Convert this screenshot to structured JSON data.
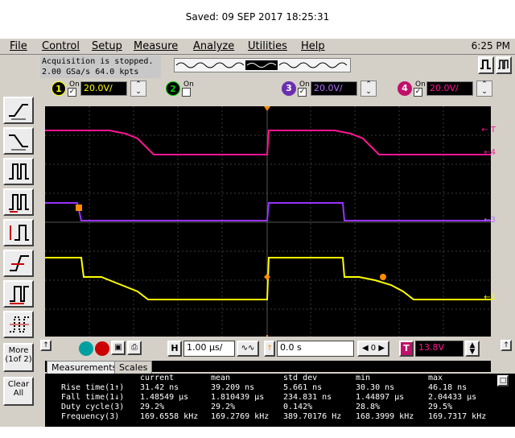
{
  "saved_caption": "Saved:  09 SEP 2017  18:25:31",
  "menu": {
    "items": [
      "File",
      "Control",
      "Setup",
      "Measure",
      "Analyze",
      "Utilities",
      "Help"
    ],
    "clock": "6:25 PM"
  },
  "acquisition": {
    "line1": "Acquisition is stopped.",
    "line2": "2.00 GSa/s   64.0 kpts"
  },
  "channels": [
    {
      "num": "1",
      "on_label": "On",
      "checked": true,
      "scale": "20.0V/",
      "color": "#ffff00"
    },
    {
      "num": "2",
      "on_label": "On",
      "checked": false,
      "scale": "",
      "color": "#00cc00"
    },
    {
      "num": "3",
      "on_label": "On",
      "checked": true,
      "scale": "20.0V/",
      "color": "#9933ff"
    },
    {
      "num": "4",
      "on_label": "On",
      "checked": true,
      "scale": "20.0V/",
      "color": "#ff1493"
    }
  ],
  "toolbar_left": {
    "more_label_1": "More",
    "more_label_2": "(1of 2)",
    "clear_label_1": "Clear",
    "clear_label_2": "All"
  },
  "horizontal": {
    "h_label": "H",
    "timebase": "1.00 µs/",
    "delay": "0.0 s",
    "trigger_label": "T",
    "trigger_level": "13.8V"
  },
  "marker_labels": {
    "t_marker": "← T",
    "ch4_marker": "←4",
    "ch3_marker": "←3",
    "ch1_marker": "←1"
  },
  "measurements": {
    "tab_measurements": "Measurements",
    "tab_scales": "Scales",
    "headers": [
      "current",
      "mean",
      "std dev",
      "min",
      "max"
    ],
    "rows": [
      {
        "label": "Rise time(1↑)",
        "values": [
          "31.42 ns",
          "39.209 ns",
          "5.661 ns",
          "30.30 ns",
          "46.18 ns"
        ]
      },
      {
        "label": "Fall time(1↓)",
        "values": [
          "1.48549 µs",
          "1.810439 µs",
          "234.831 ns",
          "1.44897 µs",
          "2.04433 µs"
        ]
      },
      {
        "label": "Duty cycle(3)",
        "values": [
          "29.2%",
          "29.2%",
          "0.142%",
          "28.8%",
          "29.5%"
        ]
      },
      {
        "label": "Frequency(3)",
        "values": [
          "169.6558 kHz",
          "169.2769 kHz",
          "389.70176 Hz",
          "168.3999 kHz",
          "169.7317 kHz"
        ]
      }
    ]
  },
  "colors": {
    "ch1": "#ffff00",
    "ch3": "#9933ff",
    "ch4": "#ff1493",
    "trigger": "#ff8c00"
  }
}
